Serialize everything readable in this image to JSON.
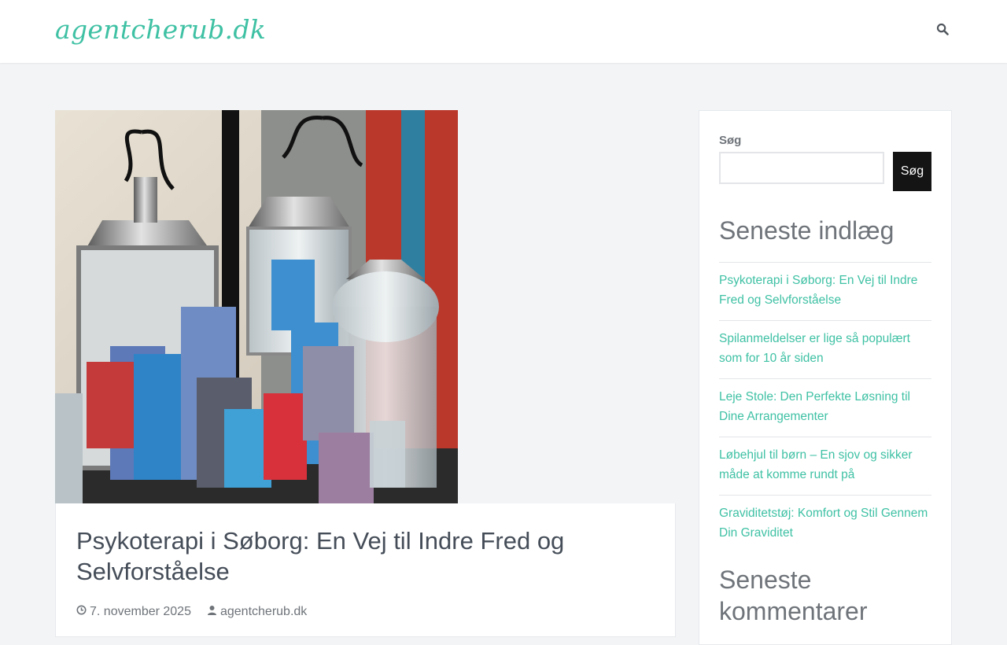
{
  "site": {
    "title": "agentcherub.dk"
  },
  "header": {
    "search_icon": "search-icon"
  },
  "post": {
    "title": "Psykoterapi i Søborg: En Vej til Indre Fred og Selvforståelse",
    "date": "7. november 2025",
    "author": "agentcherub.dk",
    "date_icon": "clock-icon",
    "author_icon": "user-icon"
  },
  "sidebar": {
    "search": {
      "label": "Søg",
      "value": "",
      "placeholder": "",
      "button_label": "Søg"
    },
    "recent_posts": {
      "title": "Seneste indlæg",
      "items": [
        "Psykoterapi i Søborg: En Vej til Indre Fred og Selvforståelse",
        "Spilanmeldelser er lige så populært som for 10 år siden",
        "Leje Stole: Den Perfekte Løsning til Dine Arrangementer",
        "Løbehjul til børn – En sjov og sikker måde at komme rundt på",
        "Graviditetstøj: Komfort og Stil Gennem Din Graviditet"
      ]
    },
    "recent_comments": {
      "title": "Seneste kommentarer"
    }
  },
  "colors": {
    "accent": "#3fc1a4",
    "background": "#f2f4f6",
    "text": "#454d58",
    "muted": "#6f747a",
    "button": "#141414"
  }
}
